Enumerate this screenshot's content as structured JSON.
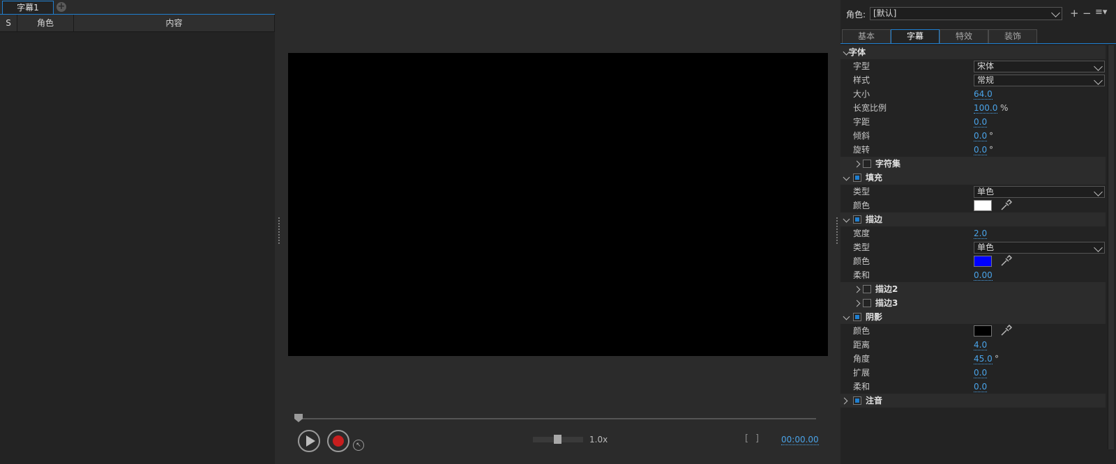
{
  "left": {
    "tab_label": "字幕1",
    "add_tab": "+",
    "columns": [
      "S",
      "角色",
      "内容"
    ]
  },
  "player": {
    "speed": "1.0x",
    "bracket_in": "[",
    "bracket_out": "]",
    "timecode": "00:00.00",
    "cursor_glyph": "↖"
  },
  "right": {
    "role_label": "角色:",
    "role_value": "[默认]",
    "role_add": "+",
    "role_remove": "−",
    "role_menu": "≡▾",
    "tabs": [
      "基本",
      "字幕",
      "特效",
      "装饰"
    ],
    "active_tab": "字幕",
    "font_section": "字体",
    "font_type_label": "字型",
    "font_type_value": "宋体",
    "style_label": "样式",
    "style_value": "常规",
    "size_label": "大小",
    "size_value": "64.0",
    "aspect_label": "长宽比例",
    "aspect_value": "100.0",
    "aspect_unit": "%",
    "spacing_label": "字距",
    "spacing_value": "0.0",
    "skew_label": "倾斜",
    "skew_value": "0.0",
    "skew_unit": "°",
    "rotate_label": "旋转",
    "rotate_value": "0.0",
    "rotate_unit": "°",
    "charset_section": "字符集",
    "fill_section": "填充",
    "fill_type_label": "类型",
    "fill_type_value": "单色",
    "fill_color_label": "颜色",
    "fill_color": "#ffffff",
    "stroke_section": "描边",
    "stroke_width_label": "宽度",
    "stroke_width_value": "2.0",
    "stroke_type_label": "类型",
    "stroke_type_value": "单色",
    "stroke_color_label": "颜色",
    "stroke_color": "#0000ff",
    "stroke_soft_label": "柔和",
    "stroke_soft_value": "0.00",
    "stroke2_section": "描边2",
    "stroke3_section": "描边3",
    "shadow_section": "阴影",
    "shadow_color_label": "颜色",
    "shadow_color": "#000000",
    "shadow_distance_label": "距离",
    "shadow_distance_value": "4.0",
    "shadow_angle_label": "角度",
    "shadow_angle_value": "45.0",
    "shadow_angle_unit": "°",
    "shadow_expand_label": "扩展",
    "shadow_expand_value": "0.0",
    "shadow_soft_label": "柔和",
    "shadow_soft_value": "0.0",
    "ruby_section": "注音"
  }
}
